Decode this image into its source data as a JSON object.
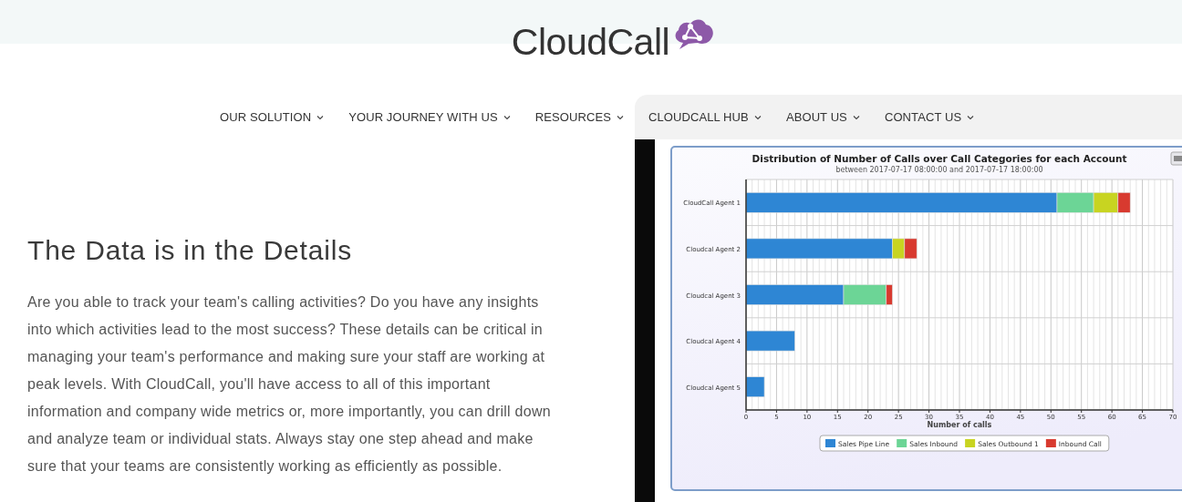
{
  "logo": {
    "text": "CloudCall"
  },
  "nav": [
    {
      "label": "OUR SOLUTION"
    },
    {
      "label": "YOUR JOURNEY WITH US"
    },
    {
      "label": "RESOURCES"
    },
    {
      "label": "CLOUDCALL HUB"
    },
    {
      "label": "ABOUT US"
    },
    {
      "label": "CONTACT US"
    }
  ],
  "intro": {
    "heading": "The Data is in the Details",
    "body": "Are you able to track your team's calling activities? Do you have any insights into which activities lead to the most success? These details can be critical in managing your team's performance and making sure your staff are working at peak levels. With CloudCall, you'll have access to all of this important information and company wide metrics or, more importantly, you can drill down and analyze team or individual stats. Always stay one step ahead and make sure that your teams are consistently working as efficiently as possible."
  },
  "chart": {
    "subtitle": "between 2017-07-17 08:00:00 and 2017-07-17 18:00:00",
    "chart_data": {
      "type": "bar",
      "orientation": "horizontal",
      "stacked": true,
      "title": "Distribution of Number of Calls over Call Categories for each Account",
      "xlabel": "Number of calls",
      "categories": [
        "CloudCall Agent 1",
        "Cloudcal Agent 2",
        "Cloudcal Agent 3",
        "Cloudcal Agent 4",
        "Cloudcal Agent 5"
      ],
      "series": [
        {
          "name": "Sales Pipe Line",
          "color": "#2e86d4",
          "values": [
            51,
            24,
            16,
            8,
            3
          ]
        },
        {
          "name": "Sales Inbound",
          "color": "#6cd596",
          "values": [
            6,
            0,
            7,
            0,
            0
          ]
        },
        {
          "name": "Sales Outbound 1",
          "color": "#c8d421",
          "values": [
            4,
            2,
            0,
            0,
            0
          ]
        },
        {
          "name": "Inbound Call",
          "color": "#d83a2f",
          "values": [
            2,
            2,
            1,
            0,
            0
          ]
        }
      ],
      "grid": true,
      "legend": true,
      "xlim": [
        0,
        70
      ],
      "xticks": [
        0,
        5,
        10,
        15,
        20,
        25,
        30,
        35,
        40,
        45,
        50,
        55,
        60,
        65,
        70
      ]
    }
  }
}
